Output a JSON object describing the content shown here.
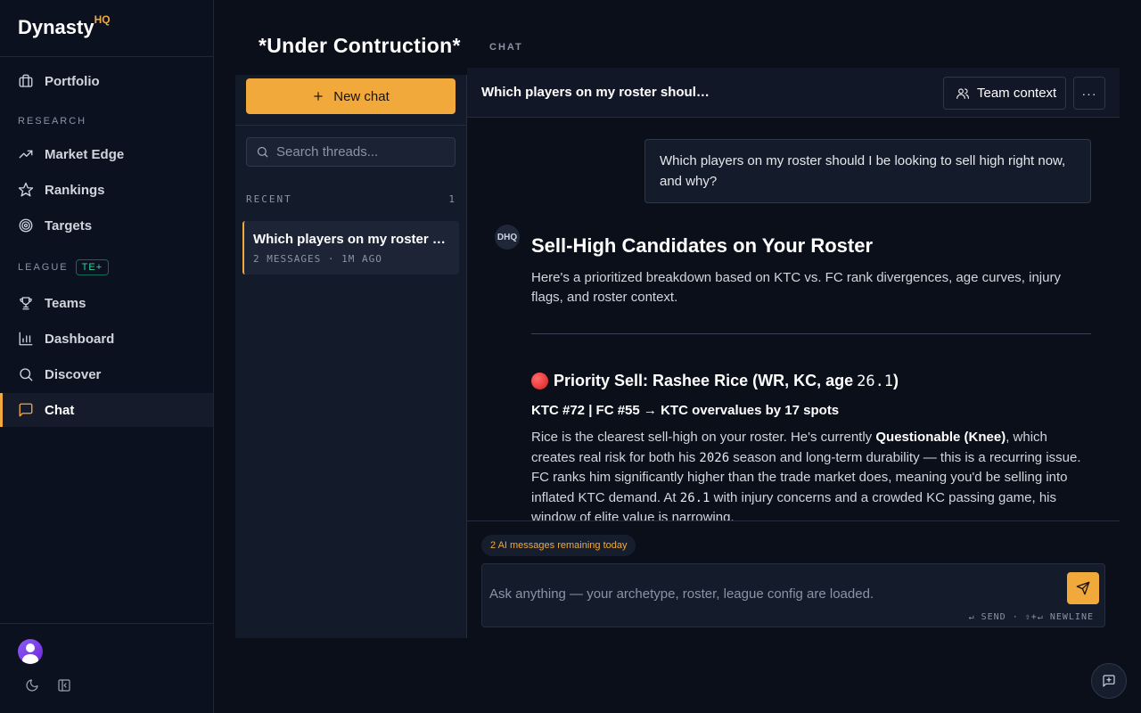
{
  "brand": {
    "name": "Dynasty",
    "suffix": "HQ"
  },
  "sidebar": {
    "items": [
      {
        "label": "Portfolio",
        "icon": "briefcase-icon"
      },
      {
        "label": "Market Edge",
        "icon": "trending-up-icon"
      },
      {
        "label": "Rankings",
        "icon": "star-icon"
      },
      {
        "label": "Targets",
        "icon": "target-icon"
      },
      {
        "label": "Teams",
        "icon": "trophy-icon"
      },
      {
        "label": "Dashboard",
        "icon": "bar-chart-icon"
      },
      {
        "label": "Discover",
        "icon": "search-icon"
      },
      {
        "label": "Chat",
        "icon": "message-square-icon",
        "active": true
      }
    ],
    "sections": {
      "research": "RESEARCH",
      "league": "LEAGUE",
      "league_badge": "TE+"
    }
  },
  "header": {
    "title": "*Under Contruction*",
    "subtitle": "CHAT"
  },
  "threads": {
    "new_chat_label": "New chat",
    "search_placeholder": "Search threads...",
    "recent_label": "RECENT",
    "recent_count": "1",
    "items": [
      {
        "title": "Which players on my roster should I be looking to sell high right now, and why?",
        "meta": "2 MESSAGES · 1M AGO"
      }
    ]
  },
  "chat": {
    "title": "Which players on my roster should I be looking to sell high right now, and why?",
    "team_context_label": "Team context",
    "more_label": "···",
    "user_message": "Which players on my roster should I be looking to sell high right now, and why?",
    "assistant_avatar": "DHQ",
    "response": {
      "heading": "Sell-High Candidates on Your Roster",
      "intro": "Here's a prioritized breakdown based on KTC vs. FC rank divergences, age curves, injury flags, and roster context.",
      "section_title": "Priority Sell: Rashee Rice (WR, KC, age ",
      "section_age": "26.1",
      "section_close": ")",
      "stat_line": "KTC #72 | FC #55 → KTC overvalues by 17 spots",
      "para_1": "Rice is the clearest sell-high on your roster. He's currently ",
      "para_bold": "Questionable (Knee)",
      "para_2": ", which creates real risk for both his ",
      "para_year": "2026",
      "para_3": " season and long-term durability — this is a recurring issue. FC ranks him significantly higher than the trade market does, meaning you'd be selling into inflated KTC demand. At ",
      "para_age": "26.1",
      "para_4": " with injury concerns and a crowded KC passing game, his window of elite value is narrowing."
    },
    "quota_text": "2 AI messages remaining today",
    "composer_placeholder": "Ask anything — your archetype, roster, league config are loaded.",
    "composer_hint": "↵ SEND · ⇧+↵ NEWLINE"
  },
  "colors": {
    "accent": "#f2a93b",
    "background": "#0b0f1a",
    "badge": "#34d399"
  }
}
